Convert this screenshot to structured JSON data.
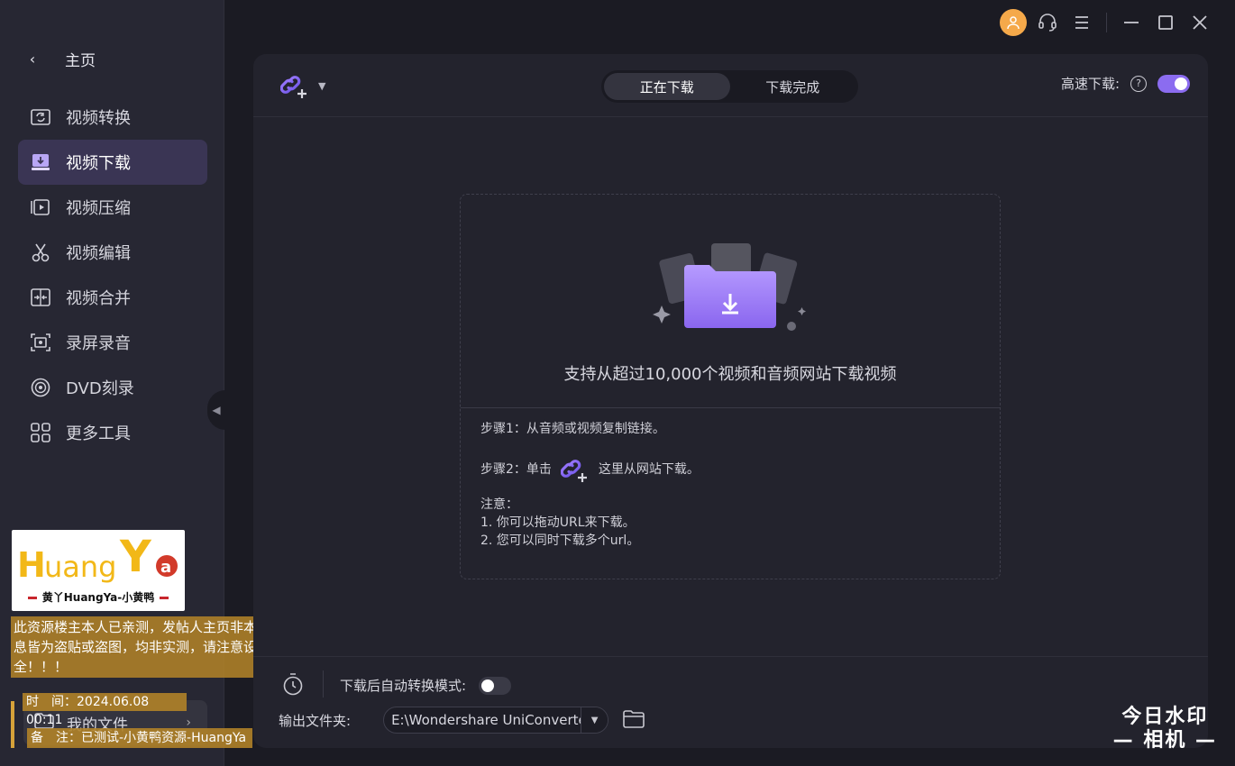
{
  "sidebar": {
    "back_label": "主页",
    "items": [
      {
        "label": "视频转换",
        "icon": "video-convert-icon"
      },
      {
        "label": "视频下载",
        "icon": "video-download-icon",
        "active": true
      },
      {
        "label": "视频压缩",
        "icon": "video-compress-icon"
      },
      {
        "label": "视频编辑",
        "icon": "scissors-icon"
      },
      {
        "label": "视频合并",
        "icon": "merge-icon"
      },
      {
        "label": "录屏录音",
        "icon": "screen-record-icon"
      },
      {
        "label": "DVD刻录",
        "icon": "dvd-burn-icon"
      },
      {
        "label": "更多工具",
        "icon": "more-tools-icon"
      }
    ],
    "my_files": "我的文件"
  },
  "header": {
    "tabs": [
      {
        "label": "正在下载",
        "active": true
      },
      {
        "label": "下载完成",
        "active": false
      }
    ],
    "speed_label": "高速下载:",
    "speed_enabled": true
  },
  "dropzone": {
    "main_text": "支持从超过10,000个视频和音频网站下载视频",
    "step1": "步骤1：从音频或视频复制链接。",
    "step2_prefix": "步骤2：单击",
    "step2_suffix": "这里从网站下载。",
    "note_title": "注意：",
    "note1": "1. 你可以拖动URL来下载。",
    "note2": "2. 您可以同时下载多个url。"
  },
  "bottom": {
    "auto_convert_label": "下载后自动转换模式:",
    "auto_convert_enabled": false,
    "output_label": "输出文件夹:",
    "output_path": "E:\\Wondershare UniConverter"
  },
  "watermark": {
    "logo_text": "HuangYa",
    "logo_sub": "黄丫HuangYa-小黄鸭",
    "notice": "此资源楼主本人已亲测，发帖人主页非本人信息皆为盗贴或盗图，均非实测，请注意设备安全！！！",
    "time": "时　间：2024.06.08 00:11",
    "note": "备　注：已测试-小黄鸭资源-HuangYa",
    "camera_line1": "今日水印",
    "camera_line2": "相机"
  },
  "colors": {
    "accent": "#8b6cf0",
    "avatar": "#f5a94a",
    "sidebar_active": "#3a3554"
  }
}
